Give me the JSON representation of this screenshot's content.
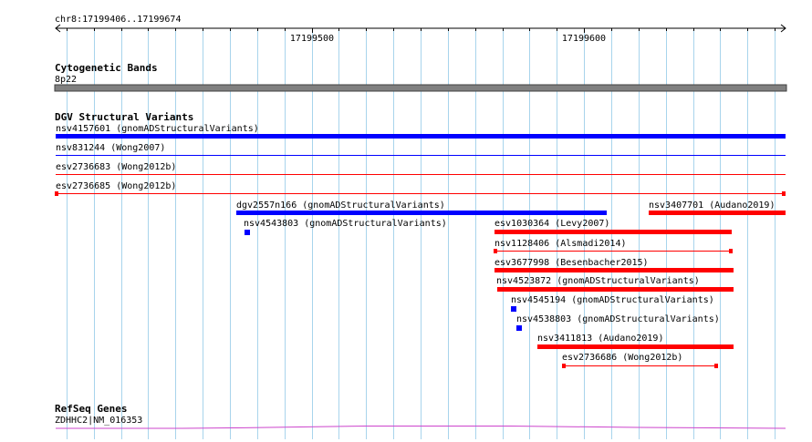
{
  "ruler": {
    "region_label": "chr8:17199406..17199674",
    "ticks": [
      {
        "label": "17199500",
        "pos": 17199500
      },
      {
        "label": "17199600",
        "pos": 17199600
      }
    ]
  },
  "region": {
    "start": 17199406,
    "end": 17199674
  },
  "tracks": {
    "cytogenetic": {
      "title": "Cytogenetic Bands",
      "band": "8p22"
    },
    "dgv": {
      "title": "DGV Structural Variants",
      "colors": {
        "blue": "#0000ff",
        "red": "#ff0000"
      },
      "features": [
        {
          "id": "nsv4157601",
          "source": "gnomADStructuralVariants",
          "label": "nsv4157601 (gnomADStructuralVariants)",
          "start": 17199406,
          "end": 17199674,
          "color": "blue",
          "style": "thick",
          "clipped_start": true,
          "clipped_end": true
        },
        {
          "id": "nsv831244",
          "source": "Wong2007",
          "label": "nsv831244 (Wong2007)",
          "start": 17199406,
          "end": 17199674,
          "color": "blue",
          "style": "line",
          "clipped_start": true,
          "clipped_end": true
        },
        {
          "id": "esv2736683",
          "source": "Wong2012b",
          "label": "esv2736683 (Wong2012b)",
          "start": 17199406,
          "end": 17199674,
          "color": "red",
          "style": "line",
          "clipped_start": true,
          "clipped_end": true
        },
        {
          "id": "esv2736685",
          "source": "Wong2012b",
          "label": "esv2736685 (Wong2012b)",
          "start": 17199406,
          "end": 17199673,
          "color": "red",
          "style": "line-capped",
          "clipped_start": false,
          "clipped_end": false
        },
        {
          "id": "dgv2557n166",
          "source": "gnomADStructuralVariants",
          "label": "dgv2557n166 (gnomADStructuralVariants)",
          "start": 17199473,
          "end": 17199608,
          "color": "blue",
          "style": "thick"
        },
        {
          "id": "nsv3407701",
          "source": "Audano2019",
          "label": "nsv3407701 (Audano2019)",
          "start": 17199623,
          "end": 17199674,
          "color": "red",
          "style": "thick",
          "clipped_end": true
        },
        {
          "id": "nsv4543803",
          "source": "gnomADStructuralVariants",
          "label": "nsv4543803 (gnomADStructuralVariants)",
          "start": 17199475,
          "end": 17199477,
          "color": "blue",
          "style": "dot"
        },
        {
          "id": "esv1030364",
          "source": "Levy2007",
          "label": "esv1030364 (Levy2007)",
          "start": 17199567,
          "end": 17199654,
          "color": "red",
          "style": "thick"
        },
        {
          "id": "nsv1128406",
          "source": "Alsmadi2014",
          "label": "nsv1128406 (Alsmadi2014)",
          "start": 17199567,
          "end": 17199654,
          "color": "red",
          "style": "line-capped"
        },
        {
          "id": "esv3677998",
          "source": "Besenbacher2015",
          "label": "esv3677998 (Besenbacher2015)",
          "start": 17199567,
          "end": 17199655,
          "color": "red",
          "style": "thick"
        },
        {
          "id": "nsv4523872",
          "source": "gnomADStructuralVariants",
          "label": "nsv4523872 (gnomADStructuralVariants)",
          "start": 17199568,
          "end": 17199655,
          "color": "red",
          "style": "thick"
        },
        {
          "id": "nsv4545194",
          "source": "gnomADStructuralVariants",
          "label": "nsv4545194 (gnomADStructuralVariants)",
          "start": 17199573,
          "end": 17199575,
          "color": "blue",
          "style": "dot"
        },
        {
          "id": "nsv4538803",
          "source": "gnomADStructuralVariants",
          "label": "nsv4538803 (gnomADStructuralVariants)",
          "start": 17199575,
          "end": 17199577,
          "color": "blue",
          "style": "dot"
        },
        {
          "id": "nsv3411813",
          "source": "Audano2019",
          "label": "nsv3411813 (Audano2019)",
          "start": 17199582,
          "end": 17199655,
          "color": "red",
          "style": "thick"
        },
        {
          "id": "esv2736686",
          "source": "Wong2012b",
          "label": "esv2736686 (Wong2012b)",
          "start": 17199591,
          "end": 17199649,
          "color": "red",
          "style": "line-capped"
        }
      ]
    },
    "refseq": {
      "title": "RefSeq Genes",
      "gene_label": "ZDHHC2|NM_016353",
      "color": "#cc44cc"
    }
  }
}
